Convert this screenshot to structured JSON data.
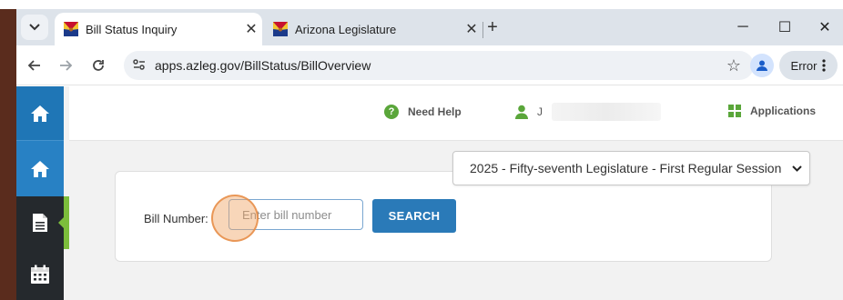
{
  "browser": {
    "tabs": [
      {
        "title": "Bill Status Inquiry",
        "active": true
      },
      {
        "title": "Arizona Legislature",
        "active": false
      }
    ],
    "new_tab": "+",
    "window_controls": {
      "minimize": "─",
      "maximize": "☐",
      "close": "✕"
    },
    "url": "apps.azleg.gov/BillStatus/BillOverview",
    "profile_status": "Error",
    "icons": {
      "back": "back-arrow-icon",
      "forward": "forward-arrow-icon",
      "reload": "reload-icon",
      "site_info": "tune-icon",
      "bookmark": "star-icon",
      "profile": "person-icon",
      "menu": "kebab-menu-icon"
    }
  },
  "sidenav": {
    "items": [
      {
        "icon": "home-icon"
      },
      {
        "icon": "home-icon"
      },
      {
        "icon": "document-icon",
        "active": true
      },
      {
        "icon": "calendar-icon"
      }
    ],
    "accent_color": "#7cbd3b"
  },
  "topbar": {
    "help_label": "Need Help",
    "user_initial": "J",
    "apps_label": "Applications"
  },
  "session_select": {
    "selected": "2025 - Fifty-seventh Legislature - First Regular Session"
  },
  "bill_search": {
    "label": "Bill Number:",
    "placeholder": "Enter bill number",
    "value": "",
    "button_label": "SEARCH"
  },
  "colors": {
    "primary": "#2a7ab8",
    "sidebar": "#2b2f33",
    "accent": "#5aa63a"
  }
}
